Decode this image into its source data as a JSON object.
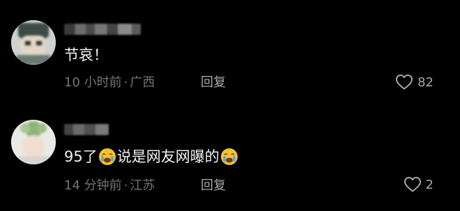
{
  "comments": [
    {
      "username": "██████",
      "text": "节哀！",
      "time": "10 小时前",
      "location": "广西",
      "reply_label": "回复",
      "like_count": "82",
      "like_icon": "heart-outline-icon"
    },
    {
      "username": "████",
      "text_before": "95了",
      "emoji_icon": "crying-face-emoji",
      "text_middle": "说是网友网曝的",
      "time": "14 分钟前",
      "location": "江苏",
      "reply_label": "回复",
      "like_count": "2",
      "like_icon": "heart-outline-icon"
    }
  ],
  "colors": {
    "background": "#000000",
    "text": "#f2f2f2",
    "meta": "#737373",
    "action": "#a8a8a8"
  }
}
